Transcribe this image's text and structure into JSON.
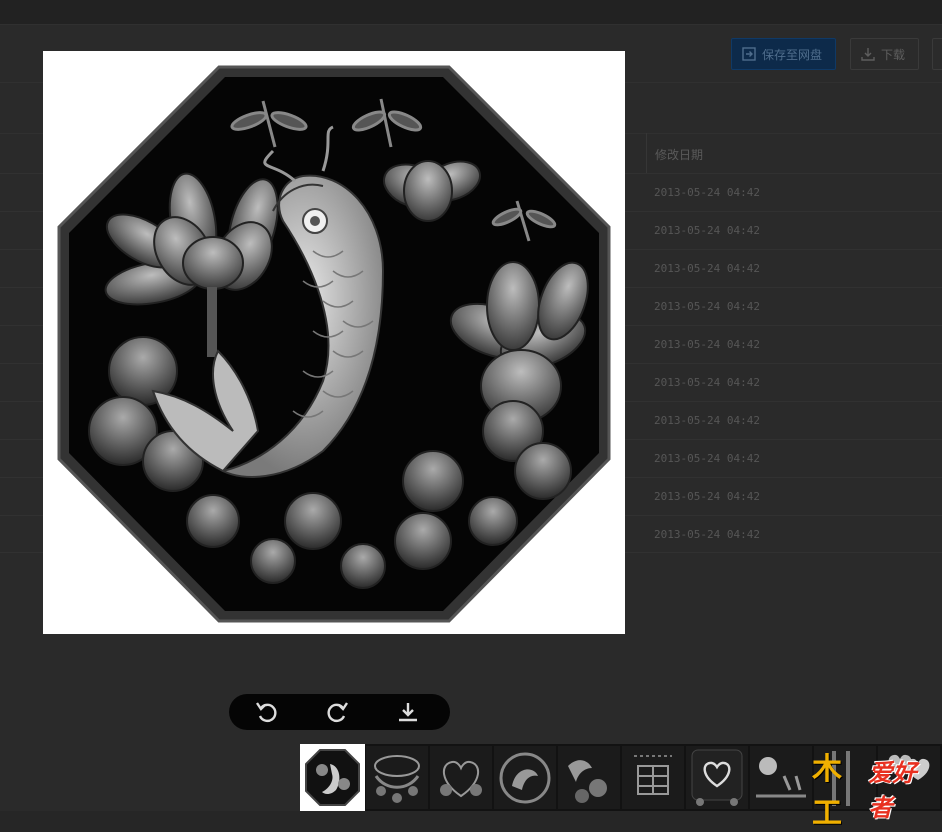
{
  "background_page": {
    "buttons": {
      "save_to_cloud": "保存至网盘",
      "download": "下载"
    },
    "column_header": "修改日期",
    "dates": [
      "2013-05-24 04:42",
      "2013-05-24 04:42",
      "2013-05-24 04:42",
      "2013-05-24 04:42",
      "2013-05-24 04:42",
      "2013-05-24 04:42",
      "2013-05-24 04:42",
      "2013-05-24 04:42",
      "2013-05-24 04:42",
      "2013-05-24 04:42"
    ]
  },
  "toolbar": {
    "buttons": [
      "rotate-left-icon",
      "rotate-right-icon",
      "download-icon"
    ]
  },
  "thumbnails": [
    "octagon-carp-lotus",
    "vase-floral",
    "heart-floral",
    "phoenix-circle",
    "bird-flowers",
    "double-happiness",
    "heart-frame",
    "dragon-plaque",
    "hearts-pair"
  ],
  "watermark": {
    "part1": "木工",
    "part2": "爱好者"
  },
  "colors": {
    "overlay": "#262626",
    "toolbar": "#050505",
    "save_button": "#0d2a4a",
    "watermark_gold": "#f0b000",
    "watermark_red": "#e83020"
  }
}
